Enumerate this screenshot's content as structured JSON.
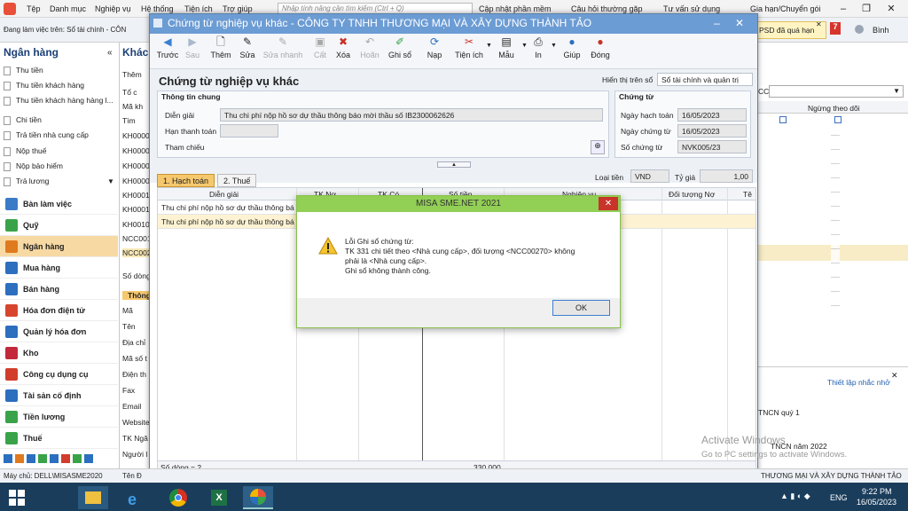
{
  "menubar": {
    "items": [
      "Tệp",
      "Danh mục",
      "Nghiệp vụ",
      "Hệ thống",
      "Tiện ích",
      "Trợ giúp"
    ],
    "search_placeholder": "Nhập tính năng cần tìm kiếm (Ctrl + Q)",
    "update": "Cập nhật phần mềm",
    "faq": "Câu hỏi thường gặp",
    "consult": "Tư vấn sử dụng",
    "renew": "Gia hạn/Chuyển gói",
    "user": "Bình",
    "psd_notice": "PSD đã quá hạn",
    "notif_count": "7"
  },
  "workspace": "Đang làm việc trên: Sổ tài chính - CÔN",
  "sidebar": {
    "title": "Ngân hàng",
    "submenu": [
      "Thu tiền",
      "Thu tiền khách hàng",
      "Thu tiền khách hàng hàng l...",
      "Chi tiền",
      "Trả tiền nhà cung cấp",
      "Nộp thuế",
      "Nộp bảo hiểm",
      "Trả lương"
    ],
    "modules": [
      "Bàn làm việc",
      "Quỹ",
      "Ngân hàng",
      "Mua hàng",
      "Bán hàng",
      "Hóa đơn điện tử",
      "Quản lý hóa đơn",
      "Kho",
      "Công cụ dụng cụ",
      "Tài sản cố định",
      "Tiền lương",
      "Thuế"
    ]
  },
  "mid_panel": {
    "header": "Khách",
    "btn1": "Thêm",
    "radio": "Tổ c",
    "col": "Mã kh",
    "search": "Tìm",
    "codes": [
      "KH0000",
      "KH0000",
      "KH0000",
      "KH0000",
      "KH0001",
      "KH0001",
      "KH0010",
      "NCC001",
      "NCC002"
    ],
    "rowcount": "Số dòng",
    "section": "Thông",
    "fields": [
      "Mã",
      "Tên",
      "Địa chỉ",
      "Mã số t",
      "Điện th",
      "Fax",
      "Email",
      "Website",
      "TK Ngâ",
      "Người l"
    ]
  },
  "modal": {
    "title": "Chứng từ nghiệp vụ khác - CÔNG TY TNHH THƯƠNG MẠI VÀ XÂY DỰNG THÀNH TẢO",
    "toolbar": [
      "Trước",
      "Sau",
      "Thêm",
      "Sửa",
      "Sửa nhanh",
      "Cất",
      "Xóa",
      "Hoãn",
      "Ghi sổ",
      "Nạp",
      "Tiện ích",
      "Mẫu",
      "In",
      "Giúp",
      "Đóng"
    ],
    "heading": "Chứng từ nghiệp vụ khác",
    "display_label": "Hiển thị trên sổ",
    "display_value": "Sổ tài chính và quản trị",
    "general_info": "Thông tin chung",
    "desc_label": "Diễn giải",
    "desc_value": "Thu chi phí nộp hồ sơ dự thầu thông báo mời thầu số IB2300062626",
    "due_label": "Hạn thanh toán",
    "ref_label": "Tham chiếu",
    "voucher": "Chứng từ",
    "posting_date_label": "Ngày hạch toán",
    "posting_date": "16/05/2023",
    "voucher_date_label": "Ngày chứng từ",
    "voucher_date": "16/05/2023",
    "voucher_no_label": "Số chứng từ",
    "voucher_no": "NVK005/23",
    "tab1": "1. Hạch toán",
    "tab2": "2. Thuế",
    "currency_label": "Loại tiền",
    "currency": "VND",
    "rate_label": "Tỷ giá",
    "rate": "1,00",
    "columns": [
      "Diễn giải",
      "TK Nợ",
      "TK Có",
      "Số tiền",
      "Nghiệp vụ",
      "Đối tượng Nợ",
      "Tê"
    ],
    "rows": [
      "Thu chi phí nộp hồ sơ dự thầu thông bá",
      "Thu chi phí nộp hồ sơ dự thầu thông bá"
    ],
    "footer_rows": "Số dòng = 2",
    "footer_total": "330.000"
  },
  "dialog": {
    "title": "MISA SME.NET 2021",
    "line1": "Lỗi Ghi sổ chứng từ:",
    "line2": "TK  331 chi tiết theo <Nhà cung cấp>, đối tượng <NCC00270> không",
    "line3": "phải là <Nhà cung cấp>.",
    "line4": "Ghi sổ không thành công.",
    "ok": "OK"
  },
  "right_panel": {
    "col": "Ngừng theo dõi",
    "cc": "CC",
    "link": "Thiết lập nhắc nhở",
    "item1": "TNCN quý 1",
    "item2": "TNCN năm 2022"
  },
  "watermark": {
    "line1": "Activate Windows",
    "line2": "Go to PC settings to activate Windows."
  },
  "statusbar": {
    "machine": "Máy chủ: DELL\\MISASME2020",
    "ten": "Tên Đ",
    "company": "THƯƠNG MẠI VÀ XÂY DỰNG THÀNH TẢO"
  },
  "taskbar": {
    "time": "9:22 PM",
    "date": "16/05/2023",
    "lang": "ENG"
  }
}
